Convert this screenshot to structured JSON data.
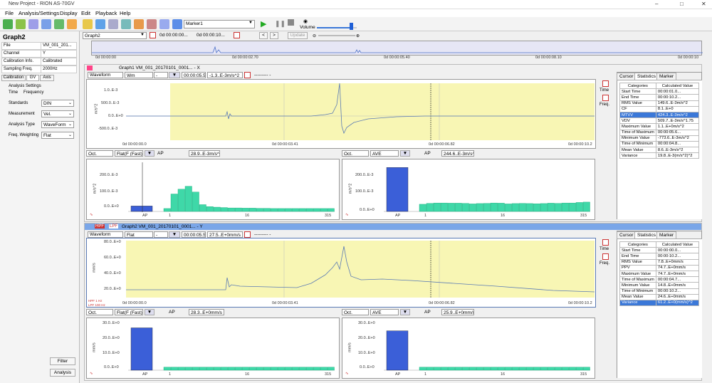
{
  "window": {
    "title": "New Project - RION AS-70GV"
  },
  "menu": [
    "File",
    "Analysis/Settings",
    "Display",
    "Edit",
    "Playback",
    "Help"
  ],
  "toolbar": {
    "marker": "Marker1",
    "volume_label": "Volume",
    "volume_level": 0.85
  },
  "overview": {
    "graph_select": "Graph2",
    "time_start": "0d 00:00:00...",
    "time_end": "0d 00:00:10...",
    "update_label": "Update",
    "ticks": [
      "0d 00:00:00",
      "0d 00:00:02.70",
      "0d 00:00:05.40",
      "0d 00:00:08.10",
      "0d 00:00:10"
    ]
  },
  "left": {
    "title": "Graph2",
    "rows": [
      {
        "k": "File",
        "v": "VM_001_201..."
      },
      {
        "k": "Channel",
        "v": "Y"
      },
      {
        "k": "Calibration Info.",
        "v": "Calibrated"
      },
      {
        "k": "Sampling Freq.",
        "v": "2000Hz"
      }
    ],
    "tabs": [
      "Calibration",
      "GV",
      "Axis"
    ],
    "analysis_title": "Analysis Settings",
    "subtabs": [
      "Time",
      "Frequency"
    ],
    "settings": [
      {
        "k": "Standards",
        "v": "DIN"
      },
      {
        "k": "Measurement",
        "v": "Vel."
      },
      {
        "k": "Analysis Type",
        "v": "WaveForm"
      },
      {
        "k": "Freq. Weighting",
        "v": "Flat"
      }
    ],
    "filter_btn": "Filter",
    "analysis_btn": "Analysis"
  },
  "graph1": {
    "header": "Graph1 VM_001_20170101_0001... - X",
    "wf_label": "Waveform",
    "wf_sel": "Wm",
    "wf_sel2": "-",
    "time_sel": "00:00:05.5...",
    "val": "-1.3..E-3m/s^2",
    "val2": "--------- -",
    "yaxis": [
      "1.0..E-3",
      "500.0..E-3",
      "0.0..E+0",
      "-500.0..E-3"
    ],
    "yunit": "m/s^2",
    "xticks": [
      "0d 00:00:00.0",
      "0d 00:00:03.41",
      "0d 00:00:06.82",
      "0d 00:00:10.2"
    ],
    "oct1": {
      "label": "Oct.",
      "weight": "Flat(F (Fast))",
      "ap": "AP",
      "val": "28.9..E-3m/s^2",
      "yaxis": [
        "200.0..E-3",
        "100.0..E-3",
        "0.0..E+0"
      ],
      "yunit": "m/s^2",
      "xticks": [
        "AP",
        "1",
        "16",
        "315"
      ]
    },
    "oct2": {
      "label": "Oct.",
      "mode": "AVE",
      "ap": "AP",
      "val": "244.6..E-3m/s^2",
      "yaxis": [
        "200.0..E-3",
        "100.0..E-3",
        "0.0..E+0"
      ],
      "yunit": "m/s^2",
      "xticks": [
        "AP",
        "1",
        "16",
        "315"
      ]
    },
    "side_tabs": [
      "Cursor",
      "Statistics",
      "Marker"
    ],
    "stats_header": [
      "Categories",
      "Calculated Value"
    ],
    "stats": [
      [
        "Start Time",
        "00:00:01.0..."
      ],
      [
        "End Time",
        "00:00:10.2..."
      ],
      [
        "RMS Value",
        "149.6..E-3m/s^2"
      ],
      [
        "CF",
        "8.1..E+0"
      ],
      [
        "MTVV",
        "424.3..E-3m/s^2"
      ],
      [
        "VDV",
        "509.7..E-3m/s^1.75"
      ],
      [
        "Maximum Value",
        "1.1..E+0m/s^2"
      ],
      [
        "Time of Maximum",
        "00:00:05.6..."
      ],
      [
        "Minimum Value",
        "-773.6..E-3m/s^2"
      ],
      [
        "Time of Minimum",
        "00:00:04.8..."
      ],
      [
        "Mean Value",
        "8.6..E-3m/s^2"
      ],
      [
        "Variance",
        "19.8..E-3(m/s^2)^2"
      ]
    ],
    "selected": 4,
    "time_btn": "Time",
    "freq_btn": "Freq."
  },
  "graph2": {
    "hpf": "HPF",
    "lpf": "LPF",
    "header": "Graph2 VM_001_20170101_0001... - Y",
    "wf_label": "Waveform",
    "wf_sel": "Flat",
    "wf_sel2": "-",
    "time_sel": "00:00:05.5...",
    "val": "27.5..E+0mm/s",
    "val2": "--------- -",
    "yaxis": [
      "80.0..E+0",
      "60.0..E+0",
      "40.0..E+0",
      "20.0..E+0"
    ],
    "yunit": "mm/s",
    "xticks": [
      "0d 00:00:00.0",
      "0d 00:00:03.41",
      "0d 00:00:06.82",
      "0d 00:00:10.2"
    ],
    "filter_note1": "HPF 1 Hz",
    "filter_note2": "LPF 100 Hz",
    "oct1": {
      "label": "Oct.",
      "weight": "Flat(F (Fast))",
      "ap": "AP",
      "val": "28.3..E+0mm/s",
      "yaxis": [
        "30.0..E+0",
        "20.0..E+0",
        "10.0..E+0",
        "0.0..E+0"
      ],
      "yunit": "mm/s",
      "xticks": [
        "AP",
        "1",
        "16",
        "315"
      ]
    },
    "oct2": {
      "label": "Oct.",
      "mode": "AVE",
      "ap": "AP",
      "val": "25.9..E+0mm/s",
      "yaxis": [
        "30.0..E+0",
        "20.0..E+0",
        "10.0..E+0",
        "0.0..E+0"
      ],
      "yunit": "mm/s",
      "xticks": [
        "AP",
        "1",
        "16",
        "315"
      ]
    },
    "side_tabs": [
      "Cursor",
      "Statistics",
      "Marker"
    ],
    "stats_header": [
      "Categories",
      "Calculated Value"
    ],
    "stats": [
      [
        "Start Time",
        "00:00:00.0..."
      ],
      [
        "End Time",
        "00:00:10.2..."
      ],
      [
        "RMS Value",
        "7.8..E+0mm/s"
      ],
      [
        "PPV",
        "74.7..E+0mm/s"
      ],
      [
        "Maximum Value",
        "74.7..E+0mm/s"
      ],
      [
        "Time of Maximum",
        "00:00:04.7..."
      ],
      [
        "Minimum Value",
        "14.8..E+0mm/s"
      ],
      [
        "Time of Minimum",
        "00:00:10.2..."
      ],
      [
        "Mean Value",
        "24.6..E+0mm/s"
      ],
      [
        "Variance",
        "61.2..E+0(mm/s)^2"
      ]
    ],
    "selected": 9,
    "time_btn": "Time",
    "freq_btn": "Freq."
  },
  "chart_data": [
    {
      "type": "bar",
      "title": "Graph1 Oct. Flat",
      "categories": [
        "AP",
        "1",
        "",
        "",
        "",
        "",
        "",
        "",
        "",
        "16",
        "",
        "",
        "",
        "",
        "",
        "",
        "",
        "",
        "",
        "",
        "",
        "",
        "",
        "",
        "315"
      ],
      "values": [
        28,
        15,
        90,
        115,
        130,
        100,
        35,
        25,
        22,
        20,
        18,
        18,
        17,
        17,
        16,
        16,
        15,
        15,
        15,
        15,
        15,
        15,
        15,
        15,
        15
      ],
      "ylim": [
        0,
        250
      ]
    },
    {
      "type": "bar",
      "title": "Graph1 Oct. AVE",
      "categories": [
        "AP",
        "1",
        "",
        "",
        "",
        "",
        "",
        "",
        "",
        "16",
        "",
        "",
        "",
        "",
        "",
        "",
        "",
        "",
        "",
        "",
        "",
        "",
        "",
        "",
        "315"
      ],
      "values": [
        245,
        40,
        45,
        47,
        47,
        46,
        46,
        45,
        42,
        44,
        45,
        47,
        46,
        42,
        44,
        45,
        44,
        43,
        44,
        46,
        45,
        47,
        47,
        50,
        52
      ],
      "ylim": [
        0,
        270
      ]
    },
    {
      "type": "bar",
      "title": "Graph2 Oct. Flat",
      "categories": [
        "AP",
        "1",
        "",
        "",
        "",
        "",
        "",
        "",
        "",
        "16",
        "",
        "",
        "",
        "",
        "",
        "",
        "",
        "",
        "",
        "",
        "",
        "",
        "",
        "",
        "315"
      ],
      "values": [
        28,
        2,
        2,
        2,
        2,
        2,
        2,
        2,
        2,
        2,
        2,
        2,
        2,
        2,
        2,
        2,
        2,
        2,
        2,
        2,
        2,
        2,
        2,
        2,
        2
      ],
      "ylim": [
        0,
        32
      ]
    },
    {
      "type": "bar",
      "title": "Graph2 Oct. AVE",
      "categories": [
        "AP",
        "1",
        "",
        "",
        "",
        "",
        "",
        "",
        "",
        "16",
        "",
        "",
        "",
        "",
        "",
        "",
        "",
        "",
        "",
        "",
        "",
        "",
        "",
        "",
        "315"
      ],
      "values": [
        26,
        2,
        2,
        2,
        2,
        2,
        2,
        2,
        2,
        2,
        2,
        2,
        2,
        2,
        2,
        2,
        2,
        2,
        2,
        2,
        2,
        2,
        2,
        2,
        2
      ],
      "ylim": [
        0,
        32
      ]
    }
  ]
}
